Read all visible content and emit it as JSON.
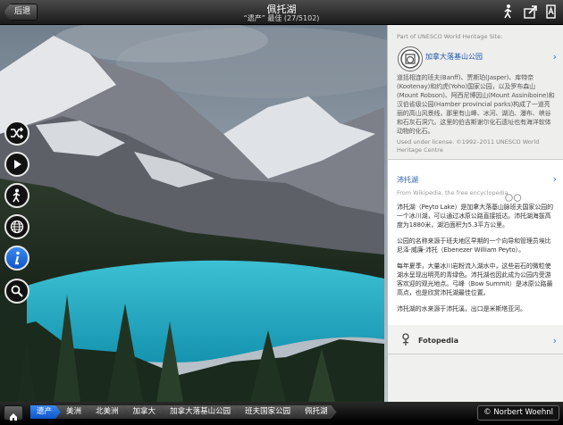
{
  "header": {
    "back_label": "后退",
    "title": "佩托湖",
    "subtitle": "“遗产” 最佳 (27/5102)"
  },
  "toolbar": {
    "hike_icon": "hiker-icon",
    "share_icon": "share-icon",
    "font_icon": "font-size-icon"
  },
  "side_buttons": [
    "shuffle-icon",
    "play-icon",
    "hiker-icon",
    "globe-icon",
    "info-icon",
    "search-icon"
  ],
  "panel": {
    "unesco": {
      "heading": "Part of UNESCO World Heritage Site:",
      "site_name": "加拿大落基山公园",
      "description": "道括相连的班夫(Banff)、贾斯珀(Jasper)、库特奈(Kootenay)和约虎(Yoho)国家公园，以及罗布森山(Mount Robson)、阿西尼博因山(Mount Assiniboine)和汉伯省级公园(Hamber provincial parks)构成了一道亮丽的高山风景线，那里有山峰、冰河、湖泊、瀑布、峡谷和石灰石洞穴。这里的伯吉斯谢尔化石遗址也有海洋软体动物的化石。",
      "license": "Used under license. ©1992–2011 UNESCO World Heritage Centre"
    },
    "wiki": {
      "name": "沛托湖",
      "source": "From Wikipedia, the free encyclopedia",
      "p1": "沛托湖（Peyto Lake）是加拿大落基山脉班夫国家公园的一个冰川湖，可以通过冰原公路直接抵达。沛托湖海拔高度为1880米，湖泊面积为5.3平方公里。",
      "p2": "公园的名称来源于班夫地区早期的一个向导和管理员埃比尼泽·威廉·沛托（Ebenezer William Peyto）。",
      "p3": "每年夏季，大量冰川岩粉流入湖水中，这些岩石的微粒使湖水呈现出明亮的青绿色。沛托湖也因此成为公园内受游客欢迎的观光地点。弓峰（Bow Summit）是冰原公路最高点，也是欣赏沛托湖最佳位置。",
      "p4": "沛托湖的水来源于沛托溪，出口是米斯塔亚河。"
    },
    "fotopedia": {
      "label": "Fotopedia"
    }
  },
  "breadcrumbs": [
    "遗产",
    "美洲",
    "北美洲",
    "加拿大",
    "加拿大落基山公园",
    "班夫国家公园",
    "佩托湖"
  ],
  "author": "Norbert Woehnl",
  "colors": {
    "accent": "#1f5aa8",
    "active_blue": "#2a74e0",
    "lake": "#2bb3c8"
  }
}
